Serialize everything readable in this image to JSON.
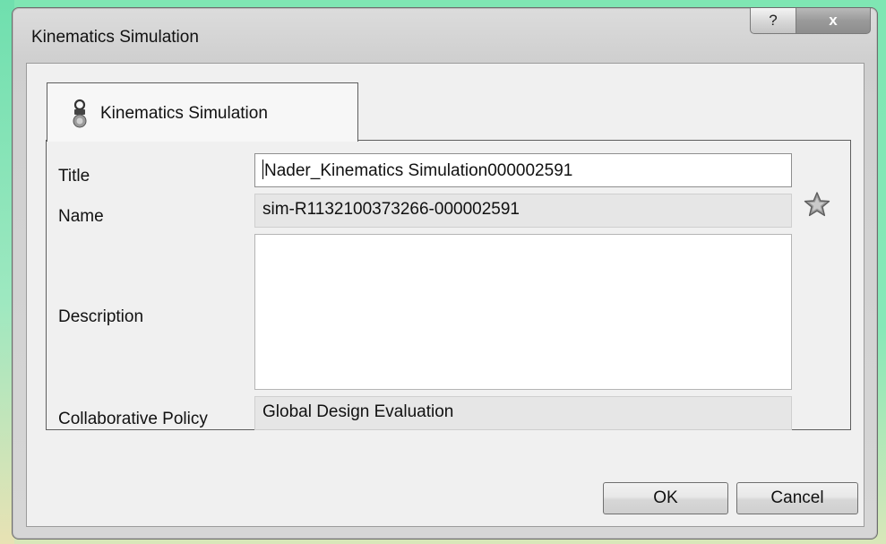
{
  "dialog": {
    "title": "Kinematics Simulation",
    "help_label": "?",
    "close_label": "x"
  },
  "tab": {
    "label": "Kinematics Simulation",
    "icon": "simulation-icon"
  },
  "form": {
    "title_label": "Title",
    "title_value": "Nader_Kinematics Simulation000002591",
    "name_label": "Name",
    "name_value": "sim-R1132100373266-000002591",
    "description_label": "Description",
    "description_value": "",
    "policy_label": "Collaborative Policy",
    "policy_value": "Global Design Evaluation",
    "favorite_icon": "star-icon"
  },
  "buttons": {
    "ok_label": "OK",
    "cancel_label": "Cancel"
  },
  "colors": {
    "desktop": "#86e8b8",
    "dialog_bg": "#f0f0f0",
    "readonly_field": "#e6e6e6"
  }
}
